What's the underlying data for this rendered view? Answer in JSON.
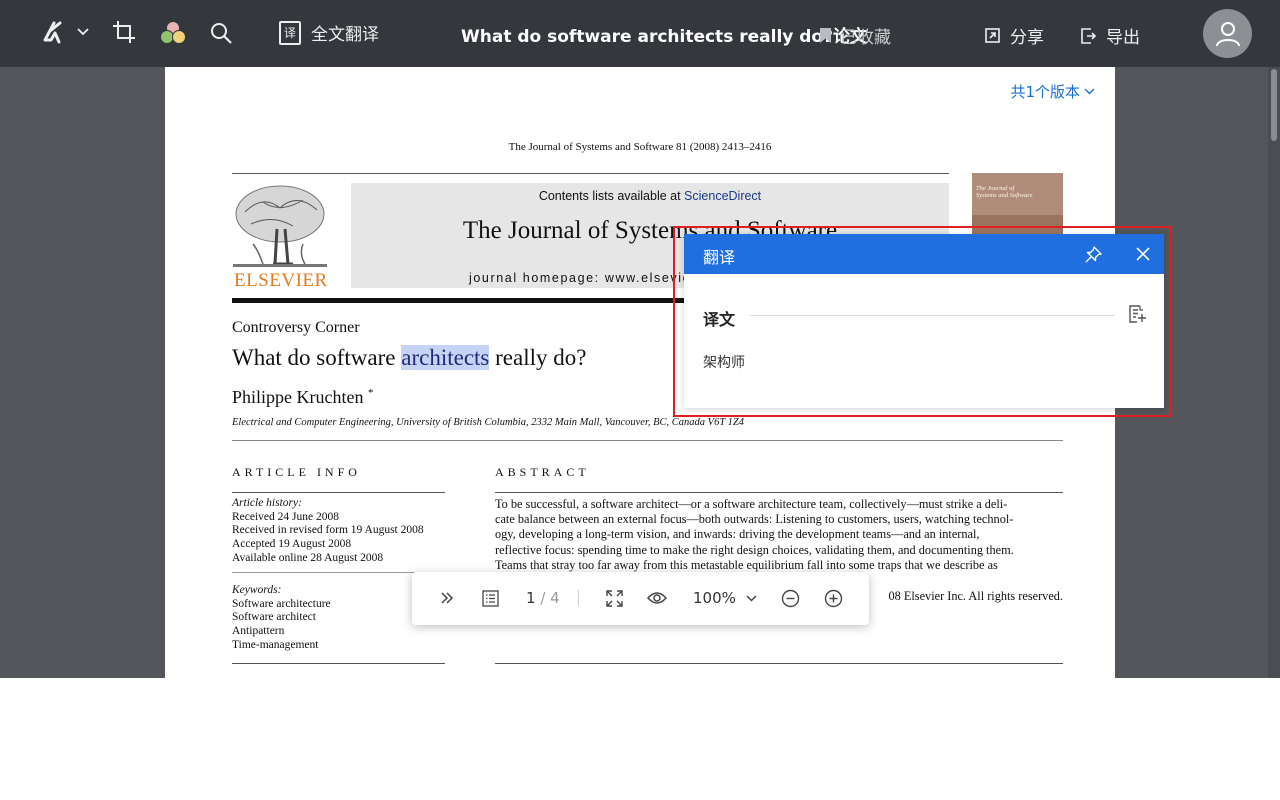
{
  "toolbar": {
    "full_translate_label": "全文翻译",
    "translate_icon_char": "译",
    "doc_title": "What do software architects really do?论文",
    "bookmark_label": "已收藏",
    "share_label": "分享",
    "export_label": "导出"
  },
  "page": {
    "versions_label": "共1个版本",
    "citation": "The Journal of Systems and Software 81 (2008) 2413–2416",
    "publisher": "ELSEVIER",
    "contents_prefix": "Contents lists available at ",
    "contents_link": "ScienceDirect",
    "journal_name": "The Journal of Systems and Software",
    "journal_homepage": "journal homepage: www.elsevier.com/locate/jss",
    "cover_title_1": "The Journal of",
    "cover_title_2": "Systems and Software",
    "section_label": "Controversy Corner",
    "title_before": "What do software ",
    "title_highlight": "architects",
    "title_after": " really do?",
    "author": "Philippe Kruchten",
    "author_mark": "*",
    "affiliation": "Electrical and Computer Engineering, University of British Columbia, 2332 Main Mall, Vancouver, BC, Canada V6T 1Z4",
    "article_info_head": "ARTICLE INFO",
    "abstract_head": "ABSTRACT",
    "history_label": "Article history:",
    "history": [
      "Received 24 June 2008",
      "Received in revised form 19 August 2008",
      "Accepted 19 August 2008",
      "Available online 28 August 2008"
    ],
    "keywords_label": "Keywords:",
    "keywords": [
      "Software architecture",
      "Software architect",
      "Antipattern",
      "Time-management"
    ],
    "abstract_lines": [
      "To be successful, a software architect—or a software architecture team, collectively—must strike a deli-",
      "cate balance between an external focus—both outwards: Listening to customers, users, watching technol-",
      "ogy, developing a long-term vision, and inwards: driving the development teams—and an internal,",
      "reflective focus: spending time to make the right design choices, validating them, and documenting them.",
      "Teams that stray too far away from this metastable equilibrium fall into some traps that we describe as"
    ],
    "copyright": "08 Elsevier Inc. All rights reserved."
  },
  "floatbar": {
    "current_page": "1",
    "total_pages": "/ 4",
    "zoom": "100%"
  },
  "popup": {
    "title": "翻译",
    "section_label": "译文",
    "translation": "架构师"
  },
  "colors": {
    "topbar": "#34373c",
    "viewer_bg": "#53565b",
    "popup_header": "#1f6fe0",
    "highlight": "#c6d3f5",
    "annotation_box": "#e02020",
    "link": "#1a6fd6",
    "elsevier_orange": "#e57a1f"
  },
  "icons": [
    "app-logo-icon",
    "chevron-down-icon",
    "crop-icon",
    "color-circles-icon",
    "search-icon",
    "translate-icon",
    "bookmark-icon",
    "share-icon",
    "export-icon",
    "user-avatar-icon",
    "double-chevron-right-icon",
    "outline-list-icon",
    "fullscreen-icon",
    "eye-icon",
    "zoom-out-icon",
    "zoom-in-icon",
    "pin-icon",
    "close-icon",
    "copy-add-icon"
  ]
}
